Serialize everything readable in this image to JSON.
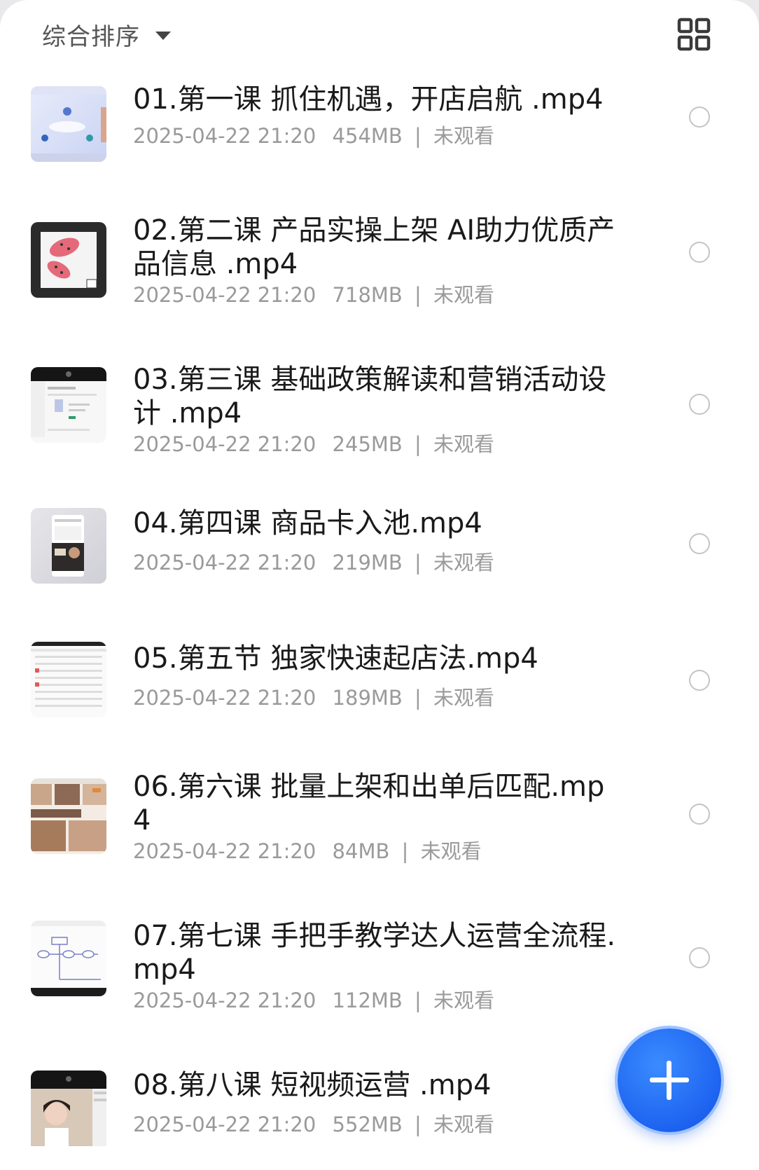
{
  "header": {
    "sort_label": "综合排序",
    "sort_icon": "caret-down-icon",
    "view_toggle_icon": "grid-view-icon"
  },
  "videos": [
    {
      "title": "01.第一课 抓住机遇，开店启航 .mp4",
      "date": "2025-04-22 21:20",
      "size": "454MB",
      "status": "未观看"
    },
    {
      "title": "02.第二课 产品实操上架 AI助力优质产品信息 .mp4",
      "date": "2025-04-22 21:20",
      "size": "718MB",
      "status": "未观看"
    },
    {
      "title": "03.第三课 基础政策解读和营销活动设计 .mp4",
      "date": "2025-04-22 21:20",
      "size": "245MB",
      "status": "未观看"
    },
    {
      "title": "04.第四课 商品卡入池.mp4",
      "date": "2025-04-22 21:20",
      "size": "219MB",
      "status": "未观看"
    },
    {
      "title": "05.第五节 独家快速起店法.mp4",
      "date": "2025-04-22 21:20",
      "size": "189MB",
      "status": "未观看"
    },
    {
      "title": "06.第六课 批量上架和出单后匹配.mp4",
      "date": "2025-04-22 21:20",
      "size": "84MB",
      "status": "未观看"
    },
    {
      "title": "07.第七课 手把手教学达人运营全流程.mp4",
      "date": "2025-04-22 21:20",
      "size": "112MB",
      "status": "未观看"
    },
    {
      "title": "08.第八课 短视频运营 .mp4",
      "date": "2025-04-22 21:20",
      "size": "552MB",
      "status": "未观看"
    }
  ],
  "meta_separator": "|",
  "fab": {
    "icon": "plus-icon"
  },
  "colors": {
    "accent": "#1d63f0",
    "title_text": "#1a1a1a",
    "meta_text": "#9a9a9a",
    "radio_border": "#c4c4c4"
  }
}
